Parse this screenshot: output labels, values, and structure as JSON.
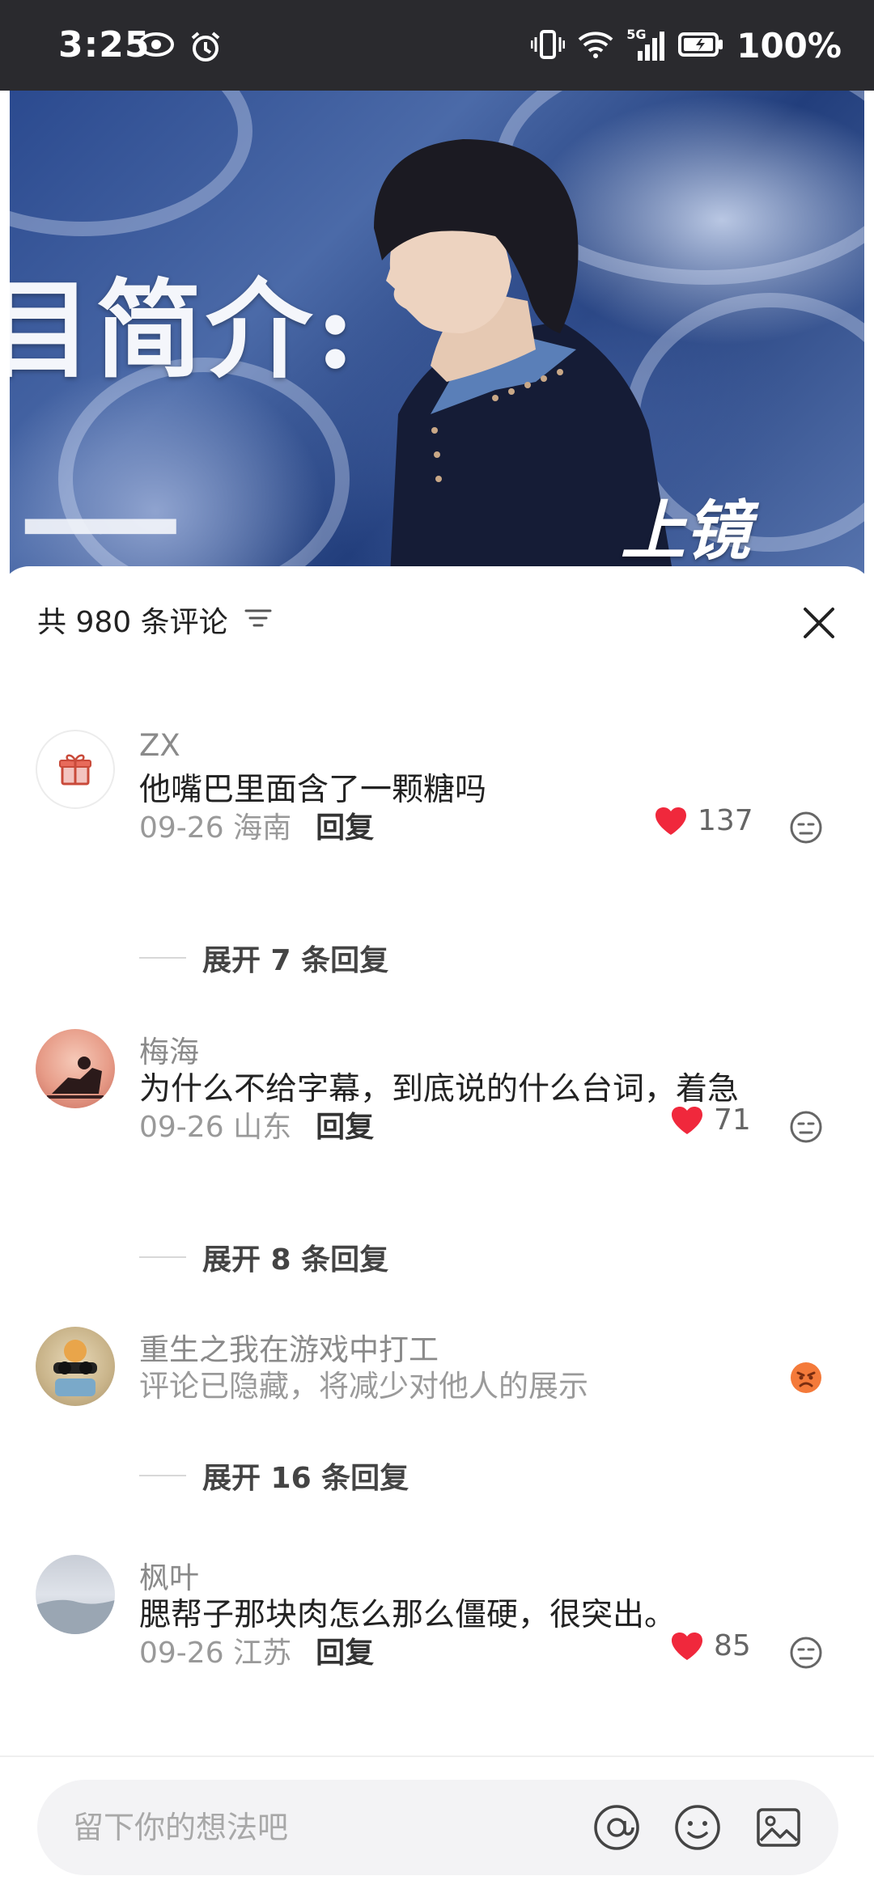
{
  "status_bar": {
    "time": "3:25",
    "network": "5G",
    "battery": "100%"
  },
  "video": {
    "title_text": "目简介:",
    "corner_text": "上镜"
  },
  "comments_panel": {
    "title": "共 980 条评论",
    "comments": [
      {
        "user": "ZX",
        "text": "他嘴巴里面含了一颗糖吗",
        "date": "09-26",
        "location": "海南",
        "reply_label": "回复",
        "likes": "137",
        "expand": "展开 7 条回复"
      },
      {
        "user": "梅海",
        "text": "为什么不给字幕，到底说的什么台词，着急",
        "date": "09-26",
        "location": "山东",
        "reply_label": "回复",
        "likes": "71",
        "expand": "展开 8 条回复"
      },
      {
        "user": "重生之我在游戏中打工",
        "text": "评论已隐藏，将减少对他人的展示",
        "expand": "展开 16 条回复"
      },
      {
        "user": "枫叶",
        "text": "腮帮子那块肉怎么那么僵硬，很突出。",
        "date": "09-26",
        "location": "江苏",
        "reply_label": "回复",
        "likes": "85"
      }
    ]
  },
  "input_bar": {
    "placeholder": "留下你的想法吧"
  },
  "colors": {
    "like_red": "#f0283c",
    "hidden_emoji_orange": "#f47a3a"
  }
}
